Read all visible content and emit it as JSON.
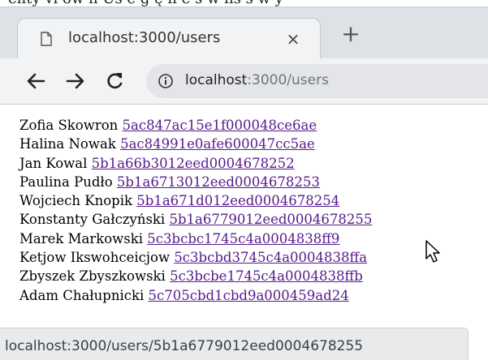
{
  "background_text": "enty  vi ów  h  Uś  e  g  ę ii  e  s  w  lis  s  w  y",
  "tab": {
    "title": "localhost:3000/users",
    "close_glyph": "×",
    "page_icon": "page-icon"
  },
  "newtab_glyph": "+",
  "toolbar": {
    "back_icon": "arrow-left-icon",
    "forward_icon": "arrow-right-icon",
    "reload_icon": "reload-icon",
    "info_icon": "info-icon",
    "url_host": "localhost",
    "url_path": ":3000/users"
  },
  "users": [
    {
      "name": "Zofia Skowron",
      "id": "5ac847ac15e1f000048ce6ae"
    },
    {
      "name": "Halina Nowak",
      "id": "5ac84991e0afe600047cc5ae"
    },
    {
      "name": "Jan Kowal",
      "id": "5b1a66b3012eed0004678252"
    },
    {
      "name": "Paulina Pudło",
      "id": "5b1a6713012eed0004678253"
    },
    {
      "name": "Wojciech Knopik",
      "id": "5b1a671d012eed0004678254"
    },
    {
      "name": "Konstanty Gałczyński",
      "id": "5b1a6779012eed0004678255"
    },
    {
      "name": "Marek Markowski",
      "id": "5c3bcbc1745c4a0004838ff9"
    },
    {
      "name": "Ketjow Ikswohceicjow",
      "id": "5c3bcbd3745c4a0004838ffa"
    },
    {
      "name": "Zbyszek Zbyszkowski",
      "id": "5c3bcbe1745c4a0004838ffb"
    },
    {
      "name": "Adam Chałupnicki",
      "id": "5c705cbd1cbd9a000459ad24"
    }
  ],
  "status_url": "localhost:3000/users/5b1a6779012eed0004678255",
  "colors": {
    "link": "#551a8b",
    "tabstrip": "#dee1e6",
    "toolbar": "#f2f3f5",
    "omnibox": "#e3e5e8"
  }
}
